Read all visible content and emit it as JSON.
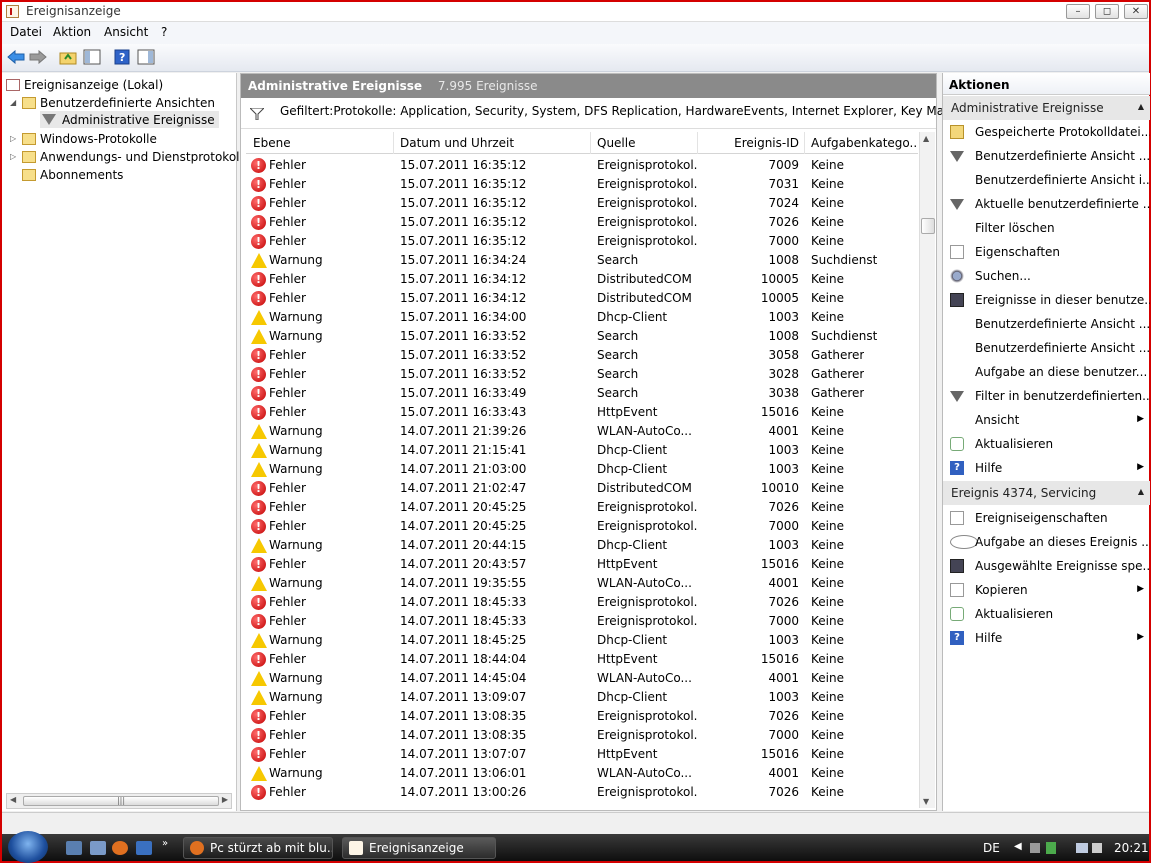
{
  "window": {
    "title": "Ereignisanzeige"
  },
  "menu": [
    "Datei",
    "Aktion",
    "Ansicht",
    "?"
  ],
  "tree": {
    "root": "Ereignisanzeige (Lokal)",
    "custom_views": "Benutzerdefinierte Ansichten",
    "admin_events": "Administrative Ereignisse",
    "windows_logs": "Windows-Protokolle",
    "app_logs": "Anwendungs- und Dienstprotokolle",
    "subscriptions": "Abonnements"
  },
  "center": {
    "title": "Administrative Ereignisse",
    "count": "7.995 Ereignisse",
    "filter": "Gefiltert:Protokolle: Application, Security, System, DFS Replication, HardwareEvents, Internet Explorer, Key Management",
    "columns": [
      "Ebene",
      "Datum und Uhrzeit",
      "Quelle",
      "Ereignis-ID",
      "Aufgabenkatego..."
    ],
    "rows": [
      {
        "level": "Fehler",
        "type": "error",
        "date": "15.07.2011 16:35:12",
        "source": "Ereignisprotokol...",
        "id": "7009",
        "category": "Keine"
      },
      {
        "level": "Fehler",
        "type": "error",
        "date": "15.07.2011 16:35:12",
        "source": "Ereignisprotokol...",
        "id": "7031",
        "category": "Keine"
      },
      {
        "level": "Fehler",
        "type": "error",
        "date": "15.07.2011 16:35:12",
        "source": "Ereignisprotokol...",
        "id": "7024",
        "category": "Keine"
      },
      {
        "level": "Fehler",
        "type": "error",
        "date": "15.07.2011 16:35:12",
        "source": "Ereignisprotokol...",
        "id": "7026",
        "category": "Keine"
      },
      {
        "level": "Fehler",
        "type": "error",
        "date": "15.07.2011 16:35:12",
        "source": "Ereignisprotokol...",
        "id": "7000",
        "category": "Keine"
      },
      {
        "level": "Warnung",
        "type": "warn",
        "date": "15.07.2011 16:34:24",
        "source": "Search",
        "id": "1008",
        "category": "Suchdienst"
      },
      {
        "level": "Fehler",
        "type": "error",
        "date": "15.07.2011 16:34:12",
        "source": "DistributedCOM",
        "id": "10005",
        "category": "Keine"
      },
      {
        "level": "Fehler",
        "type": "error",
        "date": "15.07.2011 16:34:12",
        "source": "DistributedCOM",
        "id": "10005",
        "category": "Keine"
      },
      {
        "level": "Warnung",
        "type": "warn",
        "date": "15.07.2011 16:34:00",
        "source": "Dhcp-Client",
        "id": "1003",
        "category": "Keine"
      },
      {
        "level": "Warnung",
        "type": "warn",
        "date": "15.07.2011 16:33:52",
        "source": "Search",
        "id": "1008",
        "category": "Suchdienst"
      },
      {
        "level": "Fehler",
        "type": "error",
        "date": "15.07.2011 16:33:52",
        "source": "Search",
        "id": "3058",
        "category": "Gatherer"
      },
      {
        "level": "Fehler",
        "type": "error",
        "date": "15.07.2011 16:33:52",
        "source": "Search",
        "id": "3028",
        "category": "Gatherer"
      },
      {
        "level": "Fehler",
        "type": "error",
        "date": "15.07.2011 16:33:49",
        "source": "Search",
        "id": "3038",
        "category": "Gatherer"
      },
      {
        "level": "Fehler",
        "type": "error",
        "date": "15.07.2011 16:33:43",
        "source": "HttpEvent",
        "id": "15016",
        "category": "Keine"
      },
      {
        "level": "Warnung",
        "type": "warn",
        "date": "14.07.2011 21:39:26",
        "source": "WLAN-AutoCo...",
        "id": "4001",
        "category": "Keine"
      },
      {
        "level": "Warnung",
        "type": "warn",
        "date": "14.07.2011 21:15:41",
        "source": "Dhcp-Client",
        "id": "1003",
        "category": "Keine"
      },
      {
        "level": "Warnung",
        "type": "warn",
        "date": "14.07.2011 21:03:00",
        "source": "Dhcp-Client",
        "id": "1003",
        "category": "Keine"
      },
      {
        "level": "Fehler",
        "type": "error",
        "date": "14.07.2011 21:02:47",
        "source": "DistributedCOM",
        "id": "10010",
        "category": "Keine"
      },
      {
        "level": "Fehler",
        "type": "error",
        "date": "14.07.2011 20:45:25",
        "source": "Ereignisprotokol...",
        "id": "7026",
        "category": "Keine"
      },
      {
        "level": "Fehler",
        "type": "error",
        "date": "14.07.2011 20:45:25",
        "source": "Ereignisprotokol...",
        "id": "7000",
        "category": "Keine"
      },
      {
        "level": "Warnung",
        "type": "warn",
        "date": "14.07.2011 20:44:15",
        "source": "Dhcp-Client",
        "id": "1003",
        "category": "Keine"
      },
      {
        "level": "Fehler",
        "type": "error",
        "date": "14.07.2011 20:43:57",
        "source": "HttpEvent",
        "id": "15016",
        "category": "Keine"
      },
      {
        "level": "Warnung",
        "type": "warn",
        "date": "14.07.2011 19:35:55",
        "source": "WLAN-AutoCo...",
        "id": "4001",
        "category": "Keine"
      },
      {
        "level": "Fehler",
        "type": "error",
        "date": "14.07.2011 18:45:33",
        "source": "Ereignisprotokol...",
        "id": "7026",
        "category": "Keine"
      },
      {
        "level": "Fehler",
        "type": "error",
        "date": "14.07.2011 18:45:33",
        "source": "Ereignisprotokol...",
        "id": "7000",
        "category": "Keine"
      },
      {
        "level": "Warnung",
        "type": "warn",
        "date": "14.07.2011 18:45:25",
        "source": "Dhcp-Client",
        "id": "1003",
        "category": "Keine"
      },
      {
        "level": "Fehler",
        "type": "error",
        "date": "14.07.2011 18:44:04",
        "source": "HttpEvent",
        "id": "15016",
        "category": "Keine"
      },
      {
        "level": "Warnung",
        "type": "warn",
        "date": "14.07.2011 14:45:04",
        "source": "WLAN-AutoCo...",
        "id": "4001",
        "category": "Keine"
      },
      {
        "level": "Warnung",
        "type": "warn",
        "date": "14.07.2011 13:09:07",
        "source": "Dhcp-Client",
        "id": "1003",
        "category": "Keine"
      },
      {
        "level": "Fehler",
        "type": "error",
        "date": "14.07.2011 13:08:35",
        "source": "Ereignisprotokol...",
        "id": "7026",
        "category": "Keine"
      },
      {
        "level": "Fehler",
        "type": "error",
        "date": "14.07.2011 13:08:35",
        "source": "Ereignisprotokol...",
        "id": "7000",
        "category": "Keine"
      },
      {
        "level": "Fehler",
        "type": "error",
        "date": "14.07.2011 13:07:07",
        "source": "HttpEvent",
        "id": "15016",
        "category": "Keine"
      },
      {
        "level": "Warnung",
        "type": "warn",
        "date": "14.07.2011 13:06:01",
        "source": "WLAN-AutoCo...",
        "id": "4001",
        "category": "Keine"
      },
      {
        "level": "Fehler",
        "type": "error",
        "date": "14.07.2011 13:00:26",
        "source": "Ereignisprotokol...",
        "id": "7026",
        "category": "Keine"
      }
    ]
  },
  "actions": {
    "title": "Aktionen",
    "section1": "Administrative Ereignisse",
    "items1": [
      {
        "label": "Gespeicherte Protokolldatei...",
        "icon": "folder"
      },
      {
        "label": "Benutzerdefinierte Ansicht ...",
        "icon": "filter"
      },
      {
        "label": "Benutzerdefinierte Ansicht i...",
        "icon": ""
      },
      {
        "label": "Aktuelle benutzerdefinierte ...",
        "icon": "filter"
      },
      {
        "label": "Filter löschen",
        "icon": ""
      },
      {
        "label": "Eigenschaften",
        "icon": "prop"
      },
      {
        "label": "Suchen...",
        "icon": "find"
      },
      {
        "label": "Ereignisse in dieser benutze...",
        "icon": "save"
      },
      {
        "label": "Benutzerdefinierte Ansicht ...",
        "icon": ""
      },
      {
        "label": "Benutzerdefinierte Ansicht ...",
        "icon": ""
      },
      {
        "label": "Aufgabe an diese benutzer...",
        "icon": ""
      },
      {
        "label": "Filter in benutzerdefinierten...",
        "icon": "filter"
      },
      {
        "label": "Ansicht",
        "icon": "",
        "sub": true
      },
      {
        "label": "Aktualisieren",
        "icon": "refresh"
      },
      {
        "label": "Hilfe",
        "icon": "help",
        "sub": true
      }
    ],
    "section2": "Ereignis 4374, Servicing",
    "items2": [
      {
        "label": "Ereigniseigenschaften",
        "icon": "prop"
      },
      {
        "label": "Aufgabe an dieses Ereignis ...",
        "icon": "task"
      },
      {
        "label": "Ausgewählte Ereignisse spe...",
        "icon": "save"
      },
      {
        "label": "Kopieren",
        "icon": "copy",
        "sub": true
      },
      {
        "label": "Aktualisieren",
        "icon": "refresh"
      },
      {
        "label": "Hilfe",
        "icon": "help",
        "sub": true
      }
    ]
  },
  "taskbar": {
    "tasks": [
      "Pc stürzt ab mit blu...",
      "Ereignisanzeige"
    ],
    "lang": "DE",
    "time": "20:21"
  }
}
